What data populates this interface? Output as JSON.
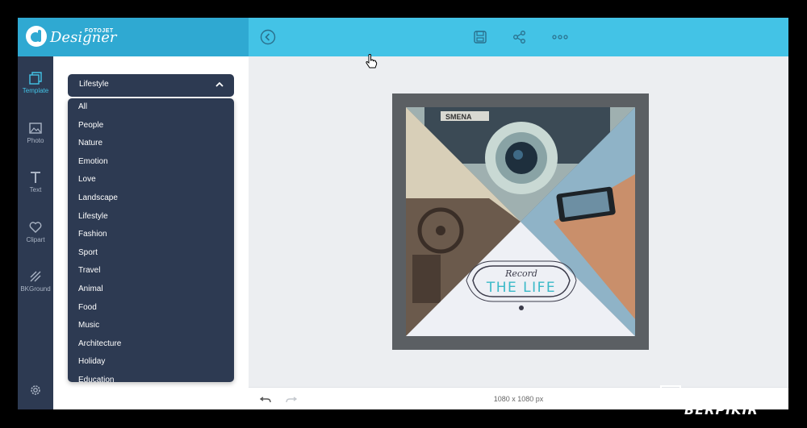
{
  "app": {
    "brand_small": "FOTOJET",
    "brand_name": "Designer"
  },
  "toolbar": {
    "back_icon": "chevron-left-circle-icon",
    "save_icon": "save-icon",
    "share_icon": "share-icon",
    "more_icon": "more-horizontal-icon"
  },
  "rail": {
    "items": [
      {
        "label": "Template",
        "icon": "template-icon",
        "active": true
      },
      {
        "label": "Photo",
        "icon": "photo-icon"
      },
      {
        "label": "Text",
        "icon": "text-icon"
      },
      {
        "label": "Clipart",
        "icon": "heart-icon"
      },
      {
        "label": "BKGround",
        "icon": "background-icon"
      }
    ],
    "settings_icon": "gear-icon"
  },
  "panel": {
    "selected_category": "Lifestyle",
    "categories": [
      "All",
      "People",
      "Nature",
      "Emotion",
      "Love",
      "Landscape",
      "Lifestyle",
      "Fashion",
      "Sport",
      "Travel",
      "Animal",
      "Food",
      "Music",
      "Architecture",
      "Holiday",
      "Education"
    ]
  },
  "poster": {
    "camera_label": "SMENA",
    "badge_top": "Record",
    "badge_main": "THE LIFE"
  },
  "bottombar": {
    "size": "1080 x 1080 px",
    "undo_icon": "undo-icon",
    "redo_icon": "redo-icon"
  },
  "watermark": {
    "text": "SENI BERPIKIR"
  },
  "colors": {
    "topbar": "#43c3e6",
    "logo_bg": "#2fa9d2",
    "rail_bg": "#2d3a52",
    "accent": "#43c3e6"
  }
}
